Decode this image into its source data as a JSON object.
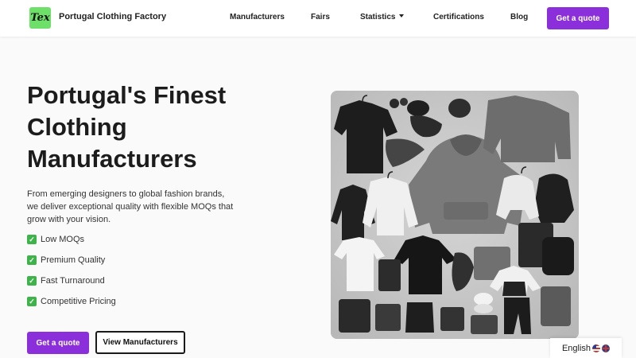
{
  "brand": {
    "logo_text": "Tex",
    "name": "Portugal Clothing Factory",
    "logo_color": "#6ee06a"
  },
  "nav": {
    "links": [
      "Manufacturers",
      "Fairs",
      "Statistics",
      "Certifications",
      "Blog"
    ],
    "cta_label": "Get a quote"
  },
  "hero": {
    "title_lines": [
      "Portugal's Finest",
      "Clothing",
      "Manufacturers"
    ],
    "description": "From emerging designers to global fashion brands, we deliver exceptional quality with flexible MOQs that grow with your vision.",
    "features": [
      "Low MOQs",
      "Premium Quality",
      "Fast Turnaround",
      "Competitive Pricing"
    ],
    "primary_button": "Get a quote",
    "secondary_button": "View Manufacturers"
  },
  "language": {
    "label": "English"
  },
  "colors": {
    "accent": "#8b2fdb",
    "check": "#3db34a"
  },
  "icons": {
    "feature_icon": "check-mark-icon",
    "dropdown_icon": "chevron-down-icon"
  }
}
